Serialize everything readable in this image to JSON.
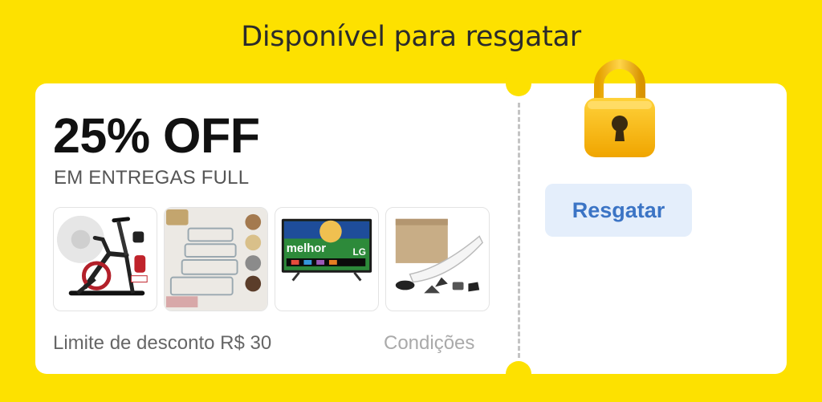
{
  "header": {
    "title": "Disponível para resgatar"
  },
  "coupon": {
    "discount": "25% OFF",
    "subtitle": "EM ENTREGAS FULL",
    "products": [
      {
        "name": "exercise-bike",
        "icon": "exercise-bike-image"
      },
      {
        "name": "storage-containers",
        "icon": "storage-containers-image"
      },
      {
        "name": "lg-tv",
        "icon": "tv-image",
        "brand_text": "melhor",
        "logo_text": "LG"
      },
      {
        "name": "satellite-dish-kit",
        "icon": "satellite-kit-image"
      }
    ],
    "limit_text": "Limite de desconto R$ 30",
    "conditions_label": "Condições",
    "redeem_label": "Resgatar",
    "lock_icon": "padlock-icon"
  },
  "colors": {
    "background": "#fde100",
    "button_bg": "#e4eefb",
    "button_text": "#3b74c5",
    "lock": "#f5b800"
  }
}
